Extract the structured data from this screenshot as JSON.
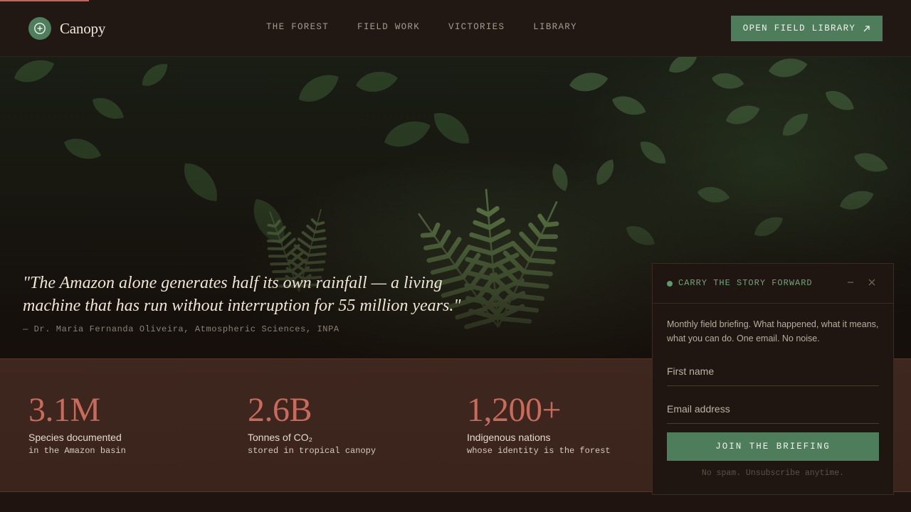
{
  "header": {
    "brand": "Canopy",
    "nav": [
      "THE FOREST",
      "FIELD WORK",
      "VICTORIES",
      "LIBRARY"
    ],
    "cta_label": "OPEN FIELD LIBRARY"
  },
  "page_progress": 0.098,
  "hero": {
    "quote": "\"The Amazon alone generates half its own rainfall — a living machine that has run without interruption for 55 million years.\"",
    "attribution": "— Dr. Maria Fernanda Oliveira, Atmospheric Sciences, INPA"
  },
  "stats": [
    {
      "value": "3.1M",
      "label": "Species documented",
      "sub": "in the Amazon basin"
    },
    {
      "value": "2.6B",
      "label": "Tonnes of CO₂",
      "sub": "stored in tropical canopy"
    },
    {
      "value": "1,200+",
      "label": "Indigenous nations",
      "sub": "whose identity is the forest"
    }
  ],
  "newsletter": {
    "title": "CARRY THE STORY FORWARD",
    "description": "Monthly field briefing. What happened, what it means, what you can do. One email. No noise.",
    "first_name_placeholder": "First name",
    "email_placeholder": "Email address",
    "button_label": "JOIN THE BRIEFING",
    "footnote": "No spam. Unsubscribe anytime."
  },
  "colors": {
    "accent_green": "#4e7d5b",
    "accent_coral": "#c96a5a",
    "stats_band": "#3e271e"
  },
  "icons": {
    "logo": "plus-in-circle-icon",
    "cta": "arrow-up-right-icon",
    "minimize": "minus-icon",
    "close": "close-icon"
  }
}
